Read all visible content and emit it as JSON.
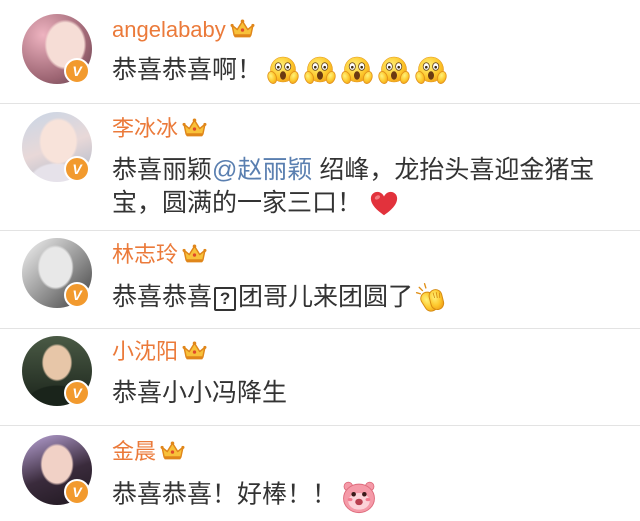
{
  "colors": {
    "username": "#eb7a3a",
    "mention": "#5a7fb0",
    "comment_text": "#333333",
    "verified_badge": "#f29a2e",
    "divider": "#e3e3e3"
  },
  "badge_mark": "V",
  "comments": [
    {
      "username": "angelababy",
      "username_icon": "crown-icon",
      "verified": true,
      "text": "恭喜恭喜啊！",
      "emoji": [
        "scream-face-icon",
        "scream-face-icon",
        "scream-face-icon",
        "scream-face-icon",
        "scream-face-icon"
      ]
    },
    {
      "username": "李冰冰",
      "username_icon": "crown-icon",
      "verified": true,
      "text_before": "恭喜丽颖",
      "mention": "@赵丽颖",
      "text_after": " 绍峰，龙抬头喜迎金猪宝",
      "text_line2": "宝，圆满的一家三口！",
      "emoji": [
        "red-heart-icon"
      ]
    },
    {
      "username": "林志玲",
      "username_icon": "crown-icon",
      "verified": true,
      "text_before": "恭喜恭喜",
      "missing_glyph": "?",
      "text_after": "团哥儿来团圆了",
      "emoji": [
        "clapping-hands-icon"
      ]
    },
    {
      "username": "小沈阳",
      "username_icon": "crown-icon",
      "verified": true,
      "text": "恭喜小小冯降生",
      "emoji": []
    },
    {
      "username": "金晨",
      "username_icon": "crown-icon",
      "verified": true,
      "text": "恭喜恭喜！好棒！！",
      "emoji": [
        "pink-creature-icon"
      ]
    }
  ]
}
